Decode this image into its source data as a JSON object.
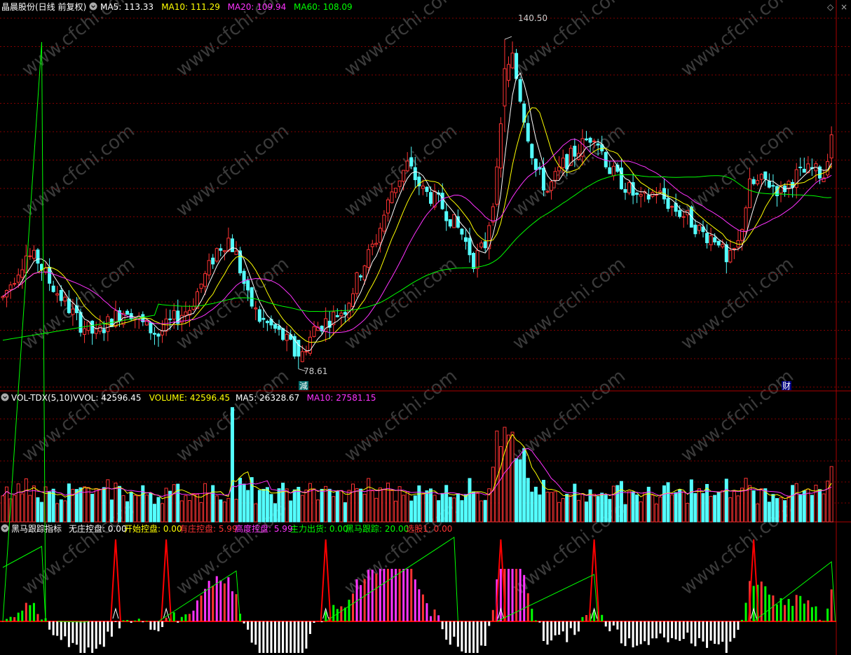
{
  "header": {
    "title": "晶晨股份(日线 前复权)",
    "ma_items": [
      {
        "label": "MA5: 113.33",
        "color": "#ffffff"
      },
      {
        "label": "MA10: 111.29",
        "color": "#ffff00"
      },
      {
        "label": "MA20: 109.94",
        "color": "#ff33ff"
      },
      {
        "label": "MA60: 108.09",
        "color": "#00ff00"
      }
    ],
    "diamond": "◇",
    "close": "×"
  },
  "price_panel": {
    "high_label": "140.50",
    "low_label": "78.61",
    "marker_jian": "減",
    "marker_cai": "财"
  },
  "volume_panel": {
    "title": "VOL-TDX(5,10)",
    "items": [
      {
        "label": "VVOL: 42596.45",
        "color": "#ffffff"
      },
      {
        "label": "VOLUME: 42596.45",
        "color": "#ffff00"
      },
      {
        "label": "MA5: 26328.67",
        "color": "#ffffff"
      },
      {
        "label": "MA10: 27581.15",
        "color": "#ff33ff"
      }
    ]
  },
  "indicator_panel": {
    "title": "黑马跟踪指标",
    "items": [
      {
        "label": "无庄控盘: 0.00",
        "color": "#ffffff"
      },
      {
        "label": "开始控盘: 0.00",
        "color": "#ffff00"
      },
      {
        "label": "有庄控盘: 5.99",
        "color": "#ff3333"
      },
      {
        "label": "高度控盘: 5.99",
        "color": "#ff33ff"
      },
      {
        "label": "主力出货: 0.00",
        "color": "#00ff00"
      },
      {
        "label": "黑马跟踪: 20.00",
        "color": "#00ff00"
      },
      {
        "label": "选股1: 0.00",
        "color": "#ff3333"
      }
    ]
  },
  "watermark": "www.cfchi.com",
  "colors": {
    "up": "#ff3333",
    "down": "#54ffff",
    "grid": "#800000",
    "ma5": "#ffffff",
    "ma10": "#ffff00",
    "ma20": "#ff33ff",
    "ma60": "#00ff00"
  },
  "chart_data": {
    "type": "candlestick",
    "stock": "晶晨股份",
    "y_range": [
      75,
      145
    ],
    "price_high": 140.5,
    "price_low": 78.61,
    "candle_count": 214,
    "anchors": [
      [
        0,
        92
      ],
      [
        3,
        96
      ],
      [
        6,
        100
      ],
      [
        9,
        99
      ],
      [
        12,
        95
      ],
      [
        16,
        91
      ],
      [
        20,
        87
      ],
      [
        24,
        85
      ],
      [
        28,
        88
      ],
      [
        32,
        90
      ],
      [
        36,
        87
      ],
      [
        40,
        85
      ],
      [
        44,
        88
      ],
      [
        48,
        90
      ],
      [
        52,
        96
      ],
      [
        55,
        101
      ],
      [
        58,
        103
      ],
      [
        60,
        100
      ],
      [
        63,
        92
      ],
      [
        66,
        88
      ],
      [
        70,
        86
      ],
      [
        74,
        83
      ],
      [
        76,
        80
      ],
      [
        80,
        86
      ],
      [
        84,
        88
      ],
      [
        88,
        90
      ],
      [
        92,
        97
      ],
      [
        96,
        103
      ],
      [
        100,
        112
      ],
      [
        104,
        117
      ],
      [
        108,
        112
      ],
      [
        112,
        110
      ],
      [
        116,
        106
      ],
      [
        118,
        104
      ],
      [
        121,
        99
      ],
      [
        124,
        102
      ],
      [
        127,
        115
      ],
      [
        129,
        133
      ],
      [
        131,
        137
      ],
      [
        134,
        126
      ],
      [
        137,
        116
      ],
      [
        140,
        112
      ],
      [
        144,
        117
      ],
      [
        148,
        120
      ],
      [
        152,
        123
      ],
      [
        156,
        116
      ],
      [
        160,
        113
      ],
      [
        164,
        110
      ],
      [
        168,
        112
      ],
      [
        172,
        109
      ],
      [
        176,
        107
      ],
      [
        180,
        104
      ],
      [
        184,
        103
      ],
      [
        186,
        98
      ],
      [
        189,
        102
      ],
      [
        192,
        113
      ],
      [
        196,
        114
      ],
      [
        200,
        112
      ],
      [
        204,
        115
      ],
      [
        208,
        116
      ],
      [
        211,
        115
      ],
      [
        213,
        123
      ]
    ],
    "volume_y_range": [
      0,
      90000
    ],
    "indicator_y_range": [
      -10,
      20
    ]
  }
}
